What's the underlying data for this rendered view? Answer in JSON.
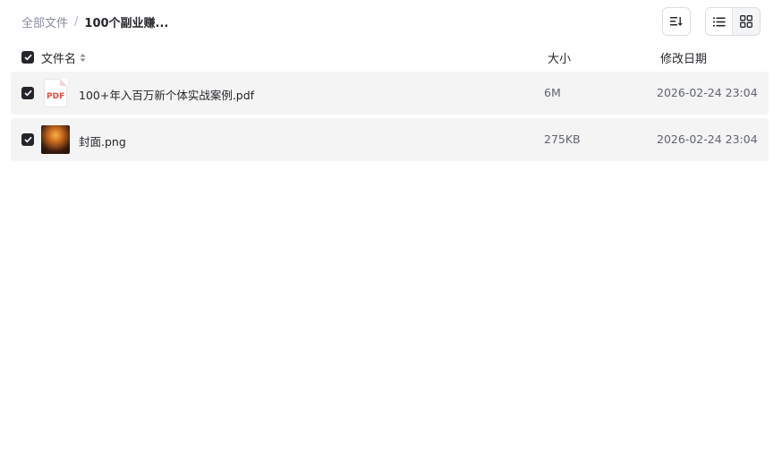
{
  "breadcrumb": {
    "root": "全部文件",
    "separator": "/",
    "current": "100个副业赚..."
  },
  "toolbar": {
    "sort_icon": "sort-icon",
    "views": [
      {
        "name": "list-view-icon",
        "active": true
      },
      {
        "name": "grid-view-icon",
        "active": false
      }
    ]
  },
  "table": {
    "columns": {
      "name": "文件名",
      "size": "大小",
      "date": "修改日期"
    },
    "rows": [
      {
        "name": "100+年入百万新个体实战案例.pdf",
        "size": "6M",
        "date": "2026-02-24 23:04",
        "icon": "pdf-file-icon",
        "icon_text": "PDF",
        "checked": true
      },
      {
        "name": "封面.png",
        "size": "275KB",
        "date": "2026-02-24 23:04",
        "icon": "image-thumbnail",
        "checked": true
      }
    ]
  },
  "colors": {
    "accent": "#25262b",
    "row_bg": "#f4f4f5",
    "muted": "#878c9c",
    "pdf_red": "#e84a3c"
  }
}
